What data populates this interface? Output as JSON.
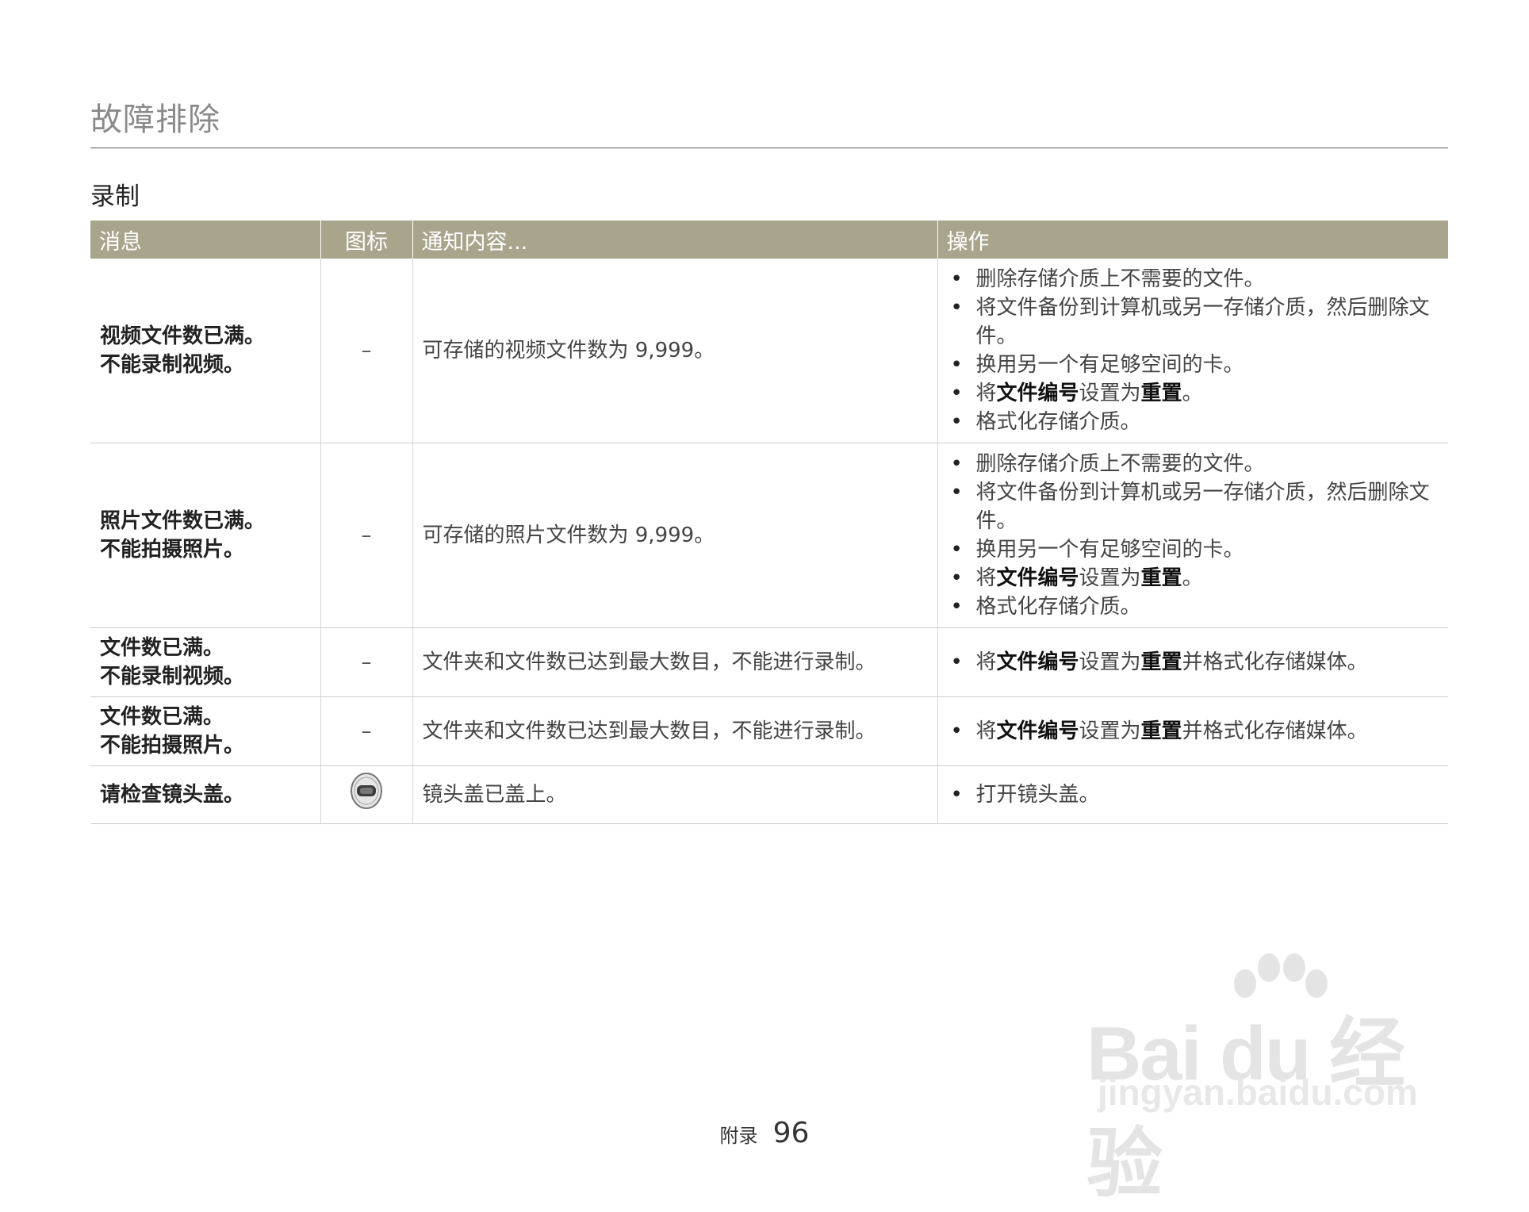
{
  "page": {
    "header": "故障排除",
    "section_title": "录制",
    "footer": {
      "label": "附录",
      "page_number": "96"
    },
    "watermark": {
      "logo": "Bai du 经验",
      "url": "jingyan.baidu.com"
    }
  },
  "table": {
    "columns": [
      "消息",
      "图标",
      "通知内容...",
      "操作"
    ],
    "header_color": "#a8a58c",
    "rows": [
      {
        "message": [
          "视频文件数已满。",
          "不能录制视频。"
        ],
        "icon": "–",
        "notice": "可存储的视频文件数为 9,999。",
        "actions": [
          {
            "text": "删除存储介质上不需要的文件。"
          },
          {
            "text": "将文件备份到计算机或另一存储介质，然后删除文件。"
          },
          {
            "text": "换用另一个有足够空间的卡。"
          },
          {
            "pre": "将",
            "bold1": "文件编号",
            "mid": "设置为",
            "bold2": "重置",
            "post": "。"
          },
          {
            "text": "格式化存储介质。"
          }
        ]
      },
      {
        "message": [
          "照片文件数已满。",
          "不能拍摄照片。"
        ],
        "icon": "–",
        "notice": "可存储的照片文件数为 9,999。",
        "actions": [
          {
            "text": "删除存储介质上不需要的文件。"
          },
          {
            "text": "将文件备份到计算机或另一存储介质，然后删除文件。"
          },
          {
            "text": "换用另一个有足够空间的卡。"
          },
          {
            "pre": "将",
            "bold1": "文件编号",
            "mid": "设置为",
            "bold2": "重置",
            "post": "。"
          },
          {
            "text": "格式化存储介质。"
          }
        ]
      },
      {
        "message": [
          "文件数已满。",
          "不能录制视频。"
        ],
        "icon": "–",
        "notice": "文件夹和文件数已达到最大数目，不能进行录制。",
        "actions": [
          {
            "pre": "将",
            "bold1": "文件编号",
            "mid": "设置为",
            "bold2": "重置",
            "post": "并格式化存储媒体。"
          }
        ]
      },
      {
        "message": [
          "文件数已满。",
          "不能拍摄照片。"
        ],
        "icon": "–",
        "notice": "文件夹和文件数已达到最大数目，不能进行录制。",
        "actions": [
          {
            "pre": "将",
            "bold1": "文件编号",
            "mid": "设置为",
            "bold2": "重置",
            "post": "并格式化存储媒体。"
          }
        ]
      },
      {
        "message": [
          "请检查镜头盖。"
        ],
        "icon": "lens-cap-icon",
        "notice": "镜头盖已盖上。",
        "actions": [
          {
            "text": "打开镜头盖。"
          }
        ]
      }
    ]
  }
}
